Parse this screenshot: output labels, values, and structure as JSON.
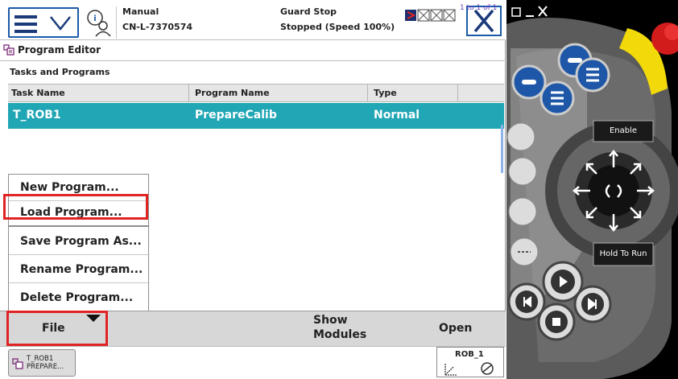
{
  "status": {
    "mode": "Manual",
    "controller": "CN-L-7370574",
    "stop_state": "Guard Stop",
    "speed_state": "Stopped (Speed 100%)"
  },
  "editor": {
    "title": "Program Editor",
    "section_title": "Tasks and Programs"
  },
  "table": {
    "headers": [
      "Task Name",
      "Program Name",
      "Type"
    ],
    "range": "1 to 1 of 1",
    "rows": [
      {
        "task": "T_ROB1",
        "program": "PrepareCalib",
        "type": "Normal"
      }
    ]
  },
  "file_menu": {
    "items": [
      "New Program...",
      "Load Program...",
      "Save Program As...",
      "Rename Program...",
      "Delete Program..."
    ]
  },
  "commands": {
    "file": "File",
    "show_modules": "Show Modules",
    "open": "Open"
  },
  "taskbar": {
    "program_task_line1": "T_ROB1",
    "program_task_line2": "PREPARE...",
    "robot": "ROB_1"
  },
  "pendant": {
    "enable": "Enable",
    "hold_to_run": "Hold To Run"
  },
  "colors": {
    "selected_row": "#20a6b5",
    "accent_blue": "#1b5aa8",
    "highlight_red": "#e02424",
    "pendant_yellow": "#f2d90a",
    "pendant_button_blue": "#1e57a8"
  },
  "icons": [
    "hamburger-icon",
    "chevron-down-icon",
    "info-user-icon",
    "task-state-icons",
    "close-icon",
    "program-editor-icon",
    "robot-frame-icon",
    "jog-arrows-icon"
  ]
}
